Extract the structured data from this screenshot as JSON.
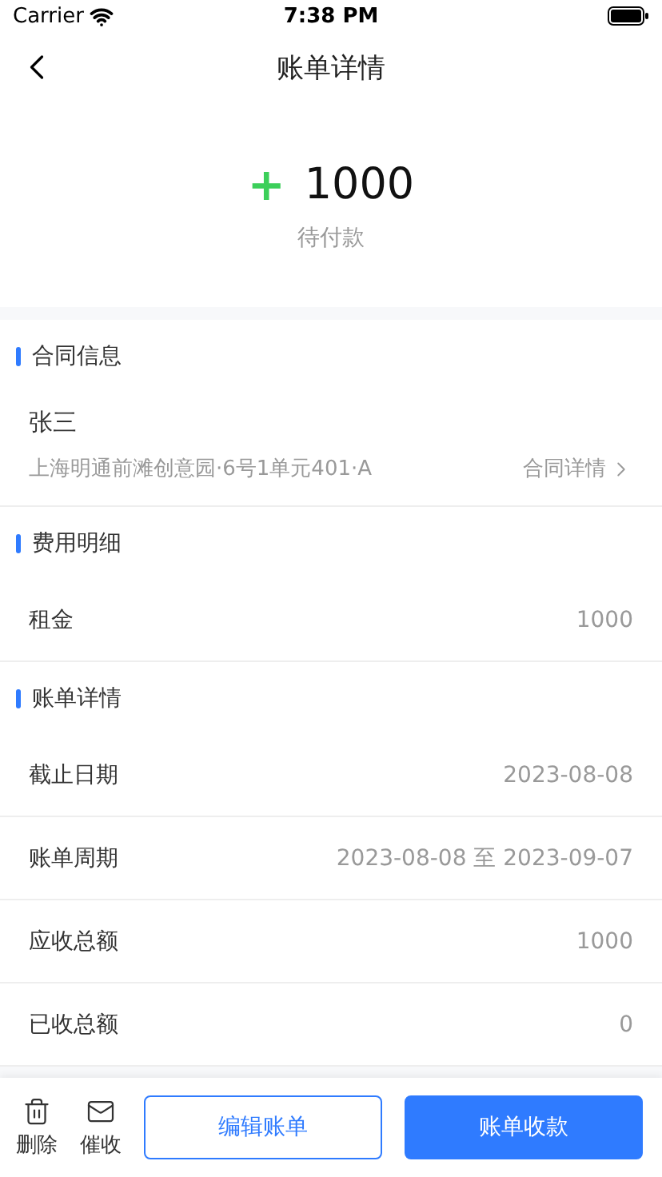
{
  "status_bar": {
    "carrier": "Carrier",
    "time": "7:38 PM"
  },
  "nav": {
    "title": "账单详情"
  },
  "summary": {
    "sign": "+",
    "amount": "1000",
    "status": "待付款"
  },
  "contract": {
    "heading": "合同信息",
    "tenant": "张三",
    "address": "上海明通前滩创意园·6号1单元401·A",
    "link": "合同详情"
  },
  "fees": {
    "heading": "费用明细",
    "rows": [
      {
        "label": "租金",
        "value": "1000"
      }
    ]
  },
  "bill": {
    "heading": "账单详情",
    "rows": [
      {
        "label": "截止日期",
        "value": "2023-08-08"
      },
      {
        "label": "账单周期",
        "value": "2023-08-08 至 2023-09-07"
      },
      {
        "label": "应收总额",
        "value": "1000"
      },
      {
        "label": "已收总额",
        "value": "0"
      }
    ]
  },
  "actions": [
    {
      "kind": "trash",
      "label": "删除"
    },
    {
      "kind": "mail",
      "label": "催收"
    },
    {
      "kind": "outline",
      "label": "编辑账单"
    },
    {
      "kind": "primary",
      "label": "账单收款"
    }
  ]
}
